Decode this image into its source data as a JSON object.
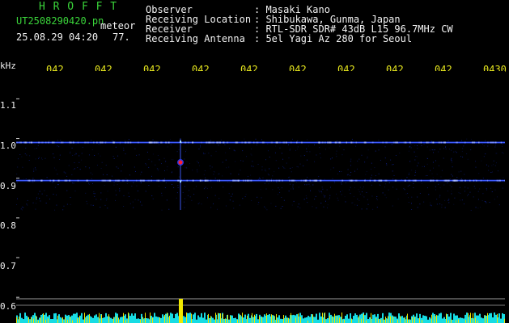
{
  "header": {
    "app_name": "H R O F F T",
    "filename": "UT2508290420.pn",
    "detection_tag": "meteor",
    "datetime": "25.08.29 04:20",
    "count": "77.",
    "info": [
      {
        "label": "Observer",
        "value": ": Masaki Kano"
      },
      {
        "label": "Receiving Location",
        "value": ": Shibukawa, Gunma, Japan"
      },
      {
        "label": "Receiver",
        "value": ": RTL-SDR SDR# 43dB L15 96.7MHz CW"
      },
      {
        "label": "Receiving Antenna",
        "value": ": 5el Yagi Az 280 for Seoul"
      }
    ]
  },
  "colors": {
    "background": "#000000",
    "header_green": "#3ad43a",
    "label_white": "#f2f2f2",
    "axis_yellow": "#e6e61e",
    "noise_blue": "#1a3cff",
    "echo_red": "#ff2030",
    "meter_cyan": "#18e8f0",
    "meter_yellow": "#f0e800"
  },
  "axes": {
    "y_unit": "kHz",
    "y_ticks": [
      "1.1",
      "1.0",
      "0.9",
      "0.8",
      "0.7",
      "0.6"
    ],
    "x_ticks": [
      "042",
      "042",
      "042",
      "042",
      "042",
      "042",
      "042",
      "042",
      "042",
      "0430"
    ]
  },
  "chart_data": {
    "type": "heatmap",
    "xlabel": "",
    "ylabel": "kHz",
    "y_range_khz": [
      0.58,
      1.17
    ],
    "noise_bands_khz": [
      0.99,
      0.894
    ],
    "events": [
      {
        "kind": "meteor echo",
        "freq_khz": 0.94
      }
    ]
  }
}
